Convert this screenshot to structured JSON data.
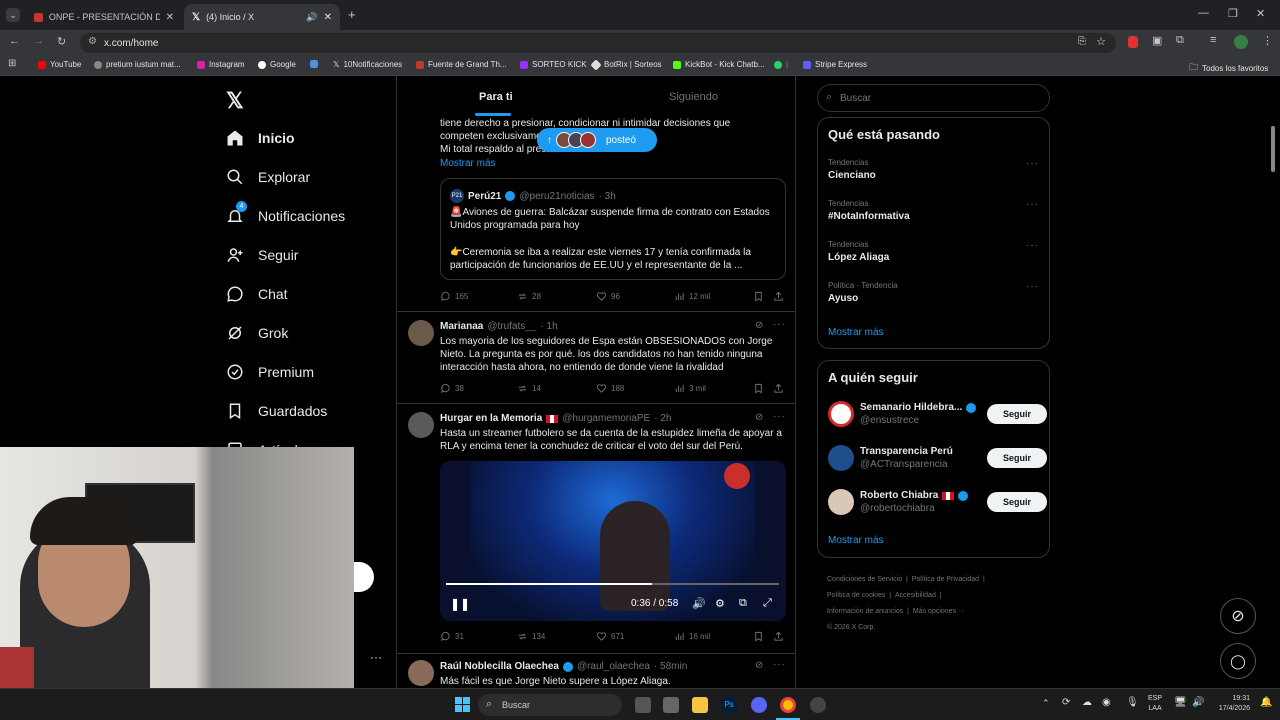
{
  "tabs": [
    {
      "title": "ONPE - PRESENTACIÓN DE RES"
    },
    {
      "title": "(4) Inicio / X"
    }
  ],
  "url": "x.com/home",
  "bookmarks": [
    "YouTube",
    "pretium iustum mat...",
    "Instagram",
    "Google",
    "10Notificaciones",
    "Fuente de Grand Th...",
    "SORTEO KICK",
    "BotRix | Sorteos",
    "KickBot - Kick Chatb...",
    "Stripe Express",
    "Todos los favoritos"
  ],
  "nav": {
    "items": [
      "Inicio",
      "Explorar",
      "Notificaciones",
      "Seguir",
      "Chat",
      "Grok",
      "Premium",
      "Guardados",
      "Artículos"
    ],
    "notif_badge": "4"
  },
  "feed": {
    "tabs": [
      "Para ti",
      "Siguiendo"
    ],
    "new_posts_label": "posteó",
    "t0": {
      "lines": [
        "tiene derecho a presionar, condicionar ni intimidar decisiones que",
        "competen exclusivame",
        "Mi total respaldo al presidente"
      ],
      "show_more": "Mostrar más",
      "quote": {
        "name": "Perú21",
        "handle": "@peru21noticias",
        "time": "· 3h",
        "line1": "🚨Aviones de guerra: Balcázar suspende firma de contrato con Estados Unidos programada para hoy",
        "line2": "👉Ceremonia se iba a realizar este viernes 17 y tenía confirmada la participación de funcionarios de EE.UU y el representante de la ..."
      },
      "stats": {
        "replies": "165",
        "reposts": "28",
        "likes": "96",
        "views": "12 mil"
      }
    },
    "t1": {
      "name": "Marianaa",
      "handle": "@trufats__",
      "time": "· 1h",
      "text": "Los mayoria de los seguidores de Espa están OBSESIONADOS con Jorge Nieto. La pregunta es por qué. los dos candidatos no han tenido ninguna interacción hasta ahora, no entiendo de donde viene la rivalidad",
      "stats": {
        "replies": "38",
        "reposts": "14",
        "likes": "188",
        "views": "3 mil"
      }
    },
    "t2": {
      "name": "Hurgar en la Memoria",
      "handle": "@hurgamemoriaPE",
      "time": "· 2h",
      "text": "Hasta un streamer futbolero se da cuenta de la estupidez limeña de apoyar a RLA y encima tener la conchudez de criticar el voto del sur del Perú.",
      "video_time": "0:36 / 0:58",
      "video_progress": 0.62,
      "stats": {
        "replies": "31",
        "reposts": "134",
        "likes": "671",
        "views": "16 mil"
      }
    },
    "t3": {
      "name": "Raúl Noblecilla Olaechea",
      "handle": "@raul_olaechea",
      "time": "· 58min",
      "text": "Más fácil es que Jorge Nieto supere a López Aliaga."
    }
  },
  "right": {
    "search_placeholder": "Buscar",
    "trends_title": "Qué está pasando",
    "trends": [
      {
        "cat": "Tendencias",
        "name": "Cienciano"
      },
      {
        "cat": "Tendencias",
        "name": "#NotaInformativa"
      },
      {
        "cat": "Tendencias",
        "name": "López Aliaga"
      },
      {
        "cat": "Política · Tendencia",
        "name": "Ayuso"
      }
    ],
    "show_more": "Mostrar más",
    "follow_title": "A quién seguir",
    "follow": [
      {
        "name": "Semanario Hildebra...",
        "handle": "@ensustrece",
        "btn": "Seguir"
      },
      {
        "name": "Transparencia Perú",
        "handle": "@ACTransparencia",
        "btn": "Seguir"
      },
      {
        "name": "Roberto Chiabra",
        "handle": "@robertochiabra",
        "btn": "Seguir"
      }
    ],
    "footer": [
      "Condiciones de Servicio",
      "|",
      "Política de Privacidad",
      "|",
      "Política de cookies",
      "|",
      "Accesibilidad",
      "|",
      "Información de anuncios",
      "|",
      "Más opciones ···",
      "© 2026 X Corp."
    ]
  },
  "taskbar": {
    "search": "Buscar",
    "lang1": "ESP",
    "lang2": "LAA",
    "time": "19:31",
    "date": "17/4/2026"
  },
  "colors": {
    "accent": "#1d9bf0",
    "bg": "#000000",
    "border": "#2f3336"
  }
}
